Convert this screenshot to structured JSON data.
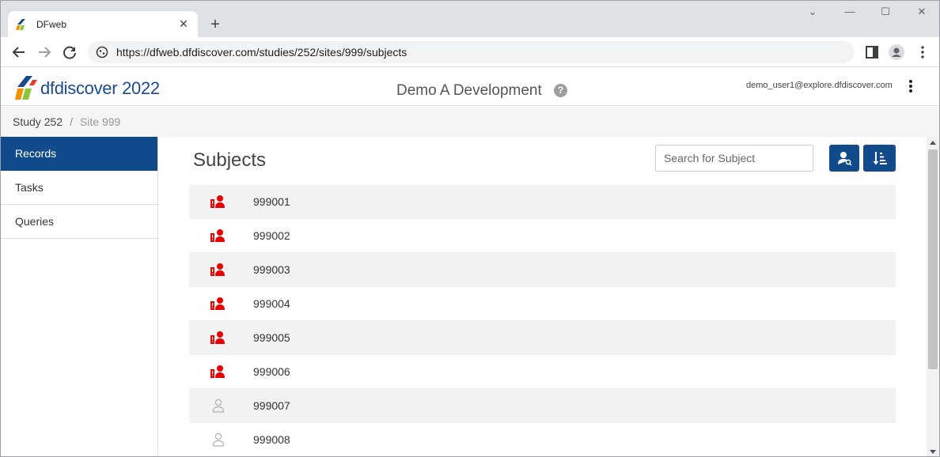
{
  "browser": {
    "tab_title": "DFweb",
    "url": "https://dfweb.dfdiscover.com/studies/252/sites/999/subjects"
  },
  "header": {
    "brand": "dfdiscover 2022",
    "study_title": "Demo A Development",
    "user_email": "demo_user1@explore.dfdiscover.com"
  },
  "breadcrumb": {
    "study": "Study 252",
    "separator": "/",
    "site": "Site 999"
  },
  "sidebar": {
    "items": [
      {
        "label": "Records",
        "active": true
      },
      {
        "label": "Tasks",
        "active": false
      },
      {
        "label": "Queries",
        "active": false
      }
    ]
  },
  "main": {
    "title": "Subjects",
    "search_placeholder": "Search for Subject",
    "subjects": [
      {
        "id": "999001",
        "icon": "subject-alert-icon"
      },
      {
        "id": "999002",
        "icon": "subject-alert-icon"
      },
      {
        "id": "999003",
        "icon": "subject-alert-icon"
      },
      {
        "id": "999004",
        "icon": "subject-alert-icon"
      },
      {
        "id": "999005",
        "icon": "subject-alert-icon"
      },
      {
        "id": "999006",
        "icon": "subject-alert-icon"
      },
      {
        "id": "999007",
        "icon": "subject-outline-icon"
      },
      {
        "id": "999008",
        "icon": "subject-outline-icon"
      }
    ]
  },
  "colors": {
    "primary": "#114b8b",
    "alert": "#e60000",
    "muted_icon": "#b0b0b0"
  }
}
